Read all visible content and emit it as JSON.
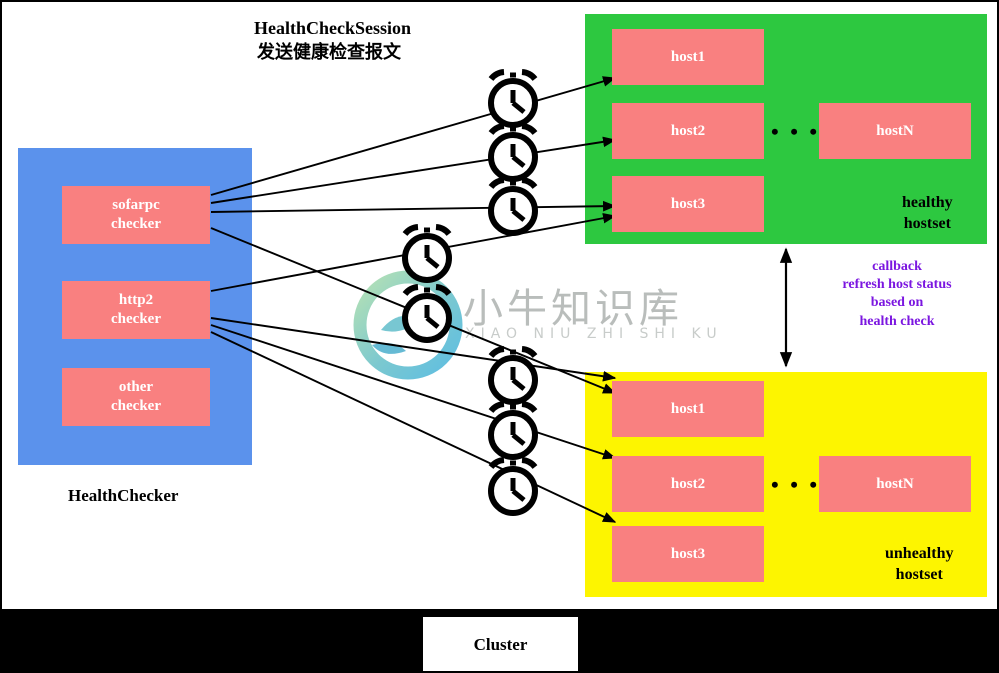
{
  "diagram": {
    "title_en": "HealthCheckSession",
    "title_cn": "发送健康检查报文",
    "cluster_label": "Cluster",
    "healthchecker_label": "HealthChecker",
    "healthy_label": "healthy\nhostset",
    "unhealthy_label": "unhealthy\nhostset",
    "callback_label": "callback\nrefresh host status\nbased on\nhealth check",
    "ellipsis": "• • •"
  },
  "watermark": {
    "cn": "小牛知识库",
    "en": "XIAO NIU ZHI SHI KU"
  },
  "healthchecker": {
    "checkers": [
      {
        "label": "sofarpc\nchecker",
        "line1": "sofarpc",
        "line2": "checker"
      },
      {
        "label": "http2\nchecker",
        "line1": "http2",
        "line2": "checker"
      },
      {
        "label": "other\nchecker",
        "line1": "other",
        "line2": "checker"
      }
    ]
  },
  "healthy_hostset": {
    "hosts": [
      "host1",
      "host2",
      "hostN",
      "host3"
    ]
  },
  "unhealthy_hostset": {
    "hosts": [
      "host1",
      "host2",
      "hostN",
      "host3"
    ]
  },
  "colors": {
    "blue_panel": "#5b92ec",
    "green_panel": "#2dc840",
    "yellow_panel": "#fdf500",
    "host_box": "#f98080",
    "callback_text": "#7b16e0",
    "band": "#000000"
  },
  "icons": {
    "clock": "alarm-clock-icon",
    "arrow": "arrow-icon",
    "double_arrow": "double-headed-arrow-icon"
  }
}
